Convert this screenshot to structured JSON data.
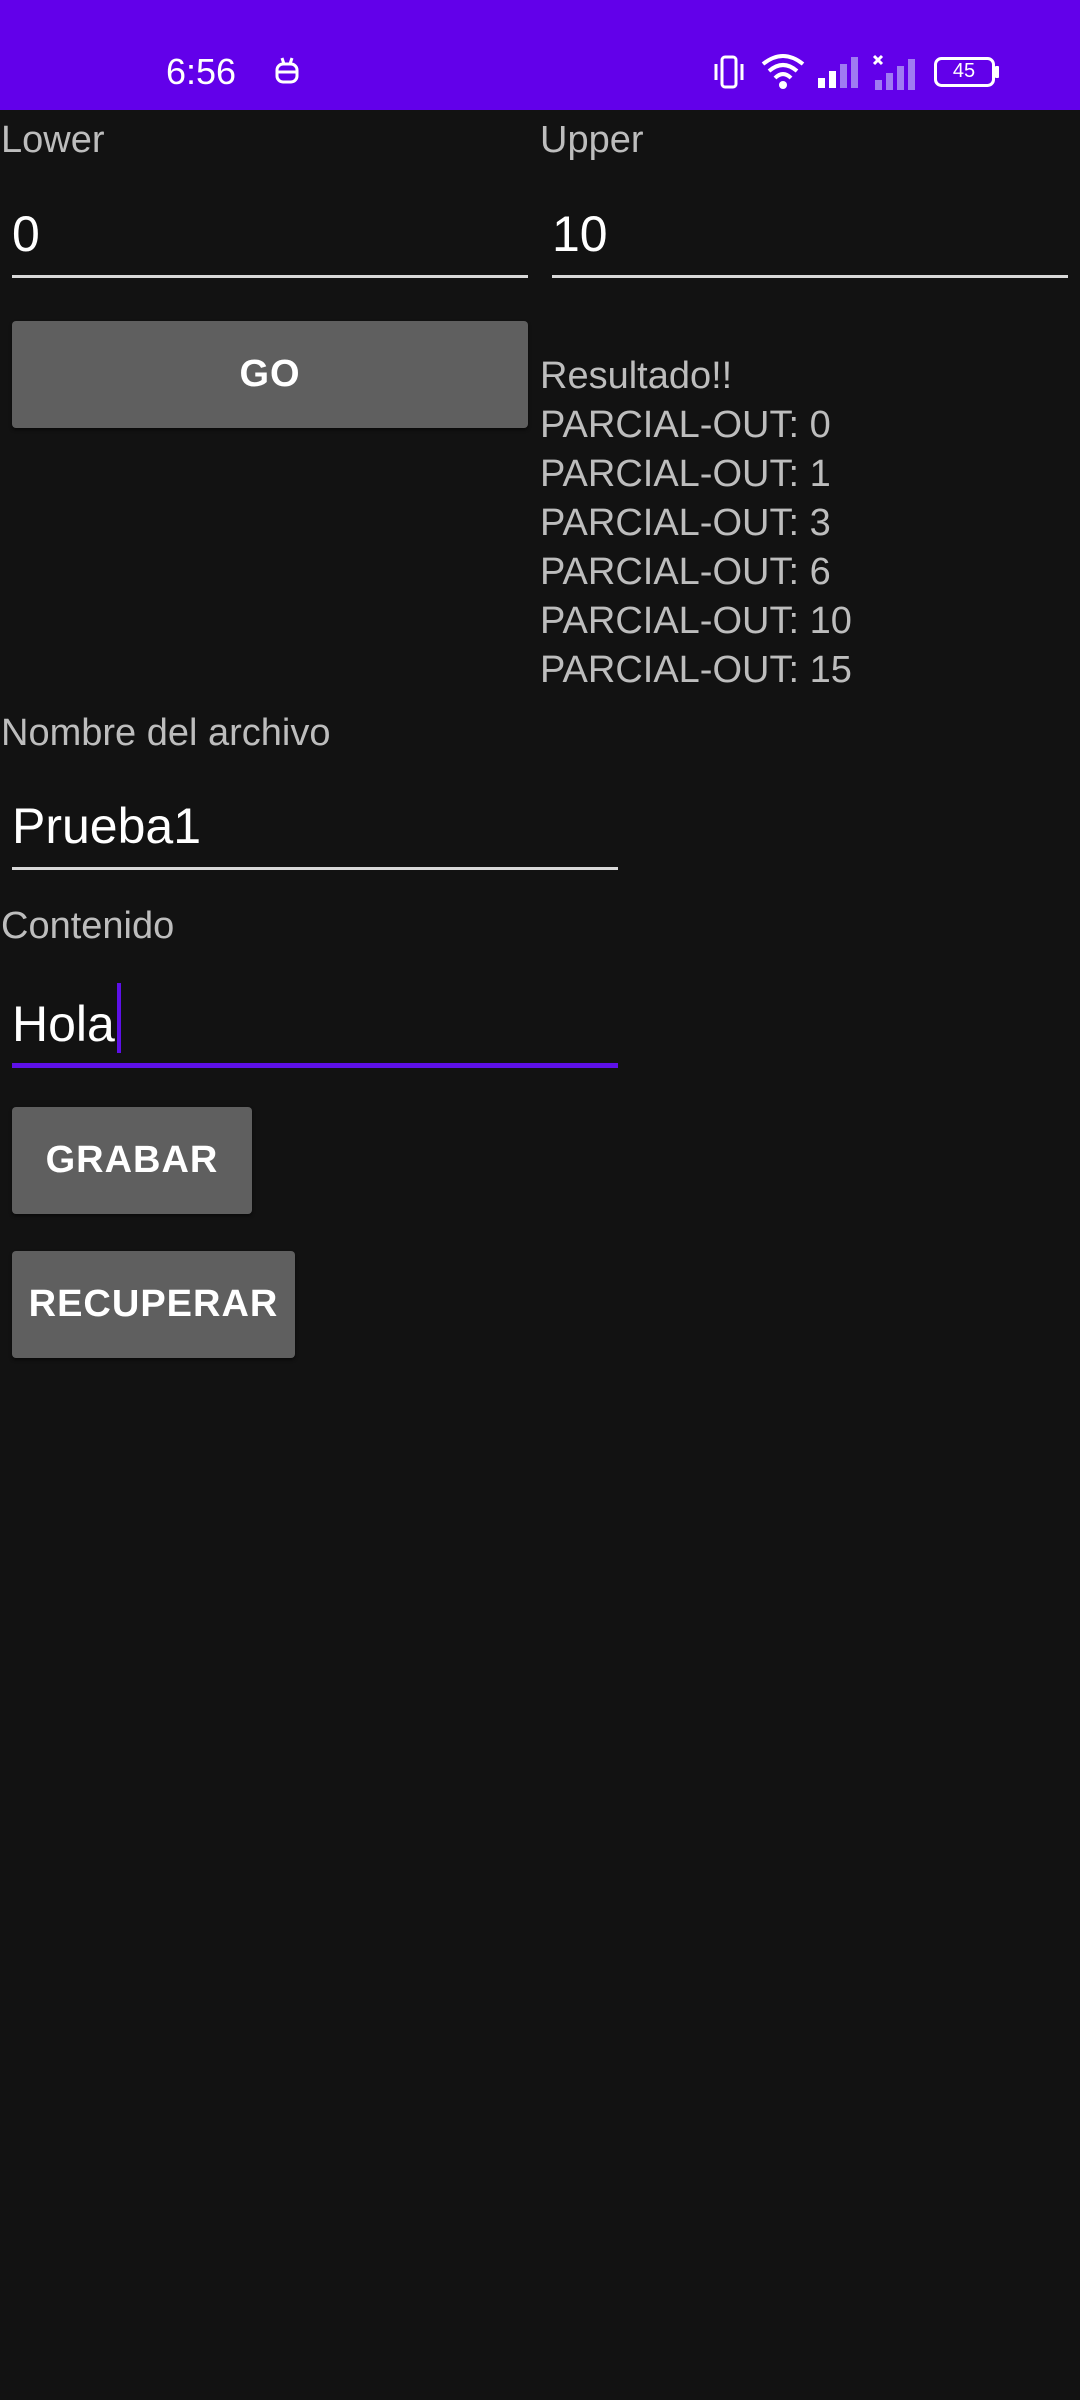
{
  "status_bar": {
    "time": "6:56",
    "battery_level": "45",
    "background_color": "#6200ea",
    "icons": [
      "usb-debug-icon",
      "vibrate-icon",
      "wifi-icon",
      "signal-icon",
      "no-signal-icon",
      "battery-icon"
    ]
  },
  "range": {
    "lower_label": "Lower",
    "lower_value": "0",
    "upper_label": "Upper",
    "upper_value": "10",
    "go_label": "GO"
  },
  "results": {
    "title": "Resultado!!",
    "lines": [
      "PARCIAL-OUT: 0",
      "PARCIAL-OUT: 1",
      "PARCIAL-OUT: 3",
      "PARCIAL-OUT: 6",
      "PARCIAL-OUT: 10",
      "PARCIAL-OUT: 15"
    ]
  },
  "file": {
    "name_label": "Nombre del archivo",
    "name_value": "Prueba1",
    "content_label": "Contenido",
    "content_value": "Hola",
    "save_label": "GRABAR",
    "recover_label": "RECUPERAR"
  },
  "colors": {
    "accent": "#5d10e8",
    "background": "#121212",
    "button": "#5f5f5f"
  }
}
